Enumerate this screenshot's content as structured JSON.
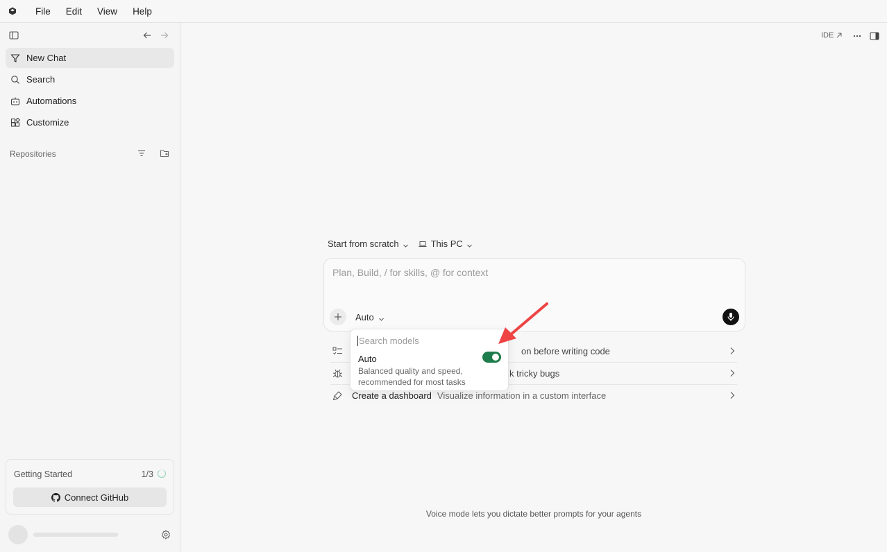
{
  "menubar": {
    "items": [
      "File",
      "Edit",
      "View",
      "Help"
    ]
  },
  "sidebar": {
    "nav": [
      {
        "label": "New Chat",
        "icon": "new-chat-icon",
        "active": true
      },
      {
        "label": "Search",
        "icon": "search-icon"
      },
      {
        "label": "Automations",
        "icon": "automations-icon"
      },
      {
        "label": "Customize",
        "icon": "customize-icon"
      }
    ],
    "repositories_label": "Repositories",
    "getting_started": {
      "title": "Getting Started",
      "progress": "1/3",
      "button": "Connect GitHub"
    }
  },
  "toolbar": {
    "ide_label": "IDE"
  },
  "composer": {
    "start_label": "Start from scratch",
    "location_label": "This PC",
    "placeholder": "Plan, Build, / for skills, @ for context",
    "model_label": "Auto"
  },
  "suggestions": [
    {
      "title": "",
      "desc": "on before writing code",
      "icon": "checklist-icon"
    },
    {
      "title": "",
      "desc": "k tricky bugs",
      "icon": "bug-icon"
    },
    {
      "title": "Create a dashboard",
      "desc": "Visualize information in a custom interface",
      "icon": "paintbrush-icon"
    }
  ],
  "model_dropdown": {
    "search_placeholder": "Search models",
    "item_name": "Auto",
    "item_desc": "Balanced quality and speed, recommended for most tasks",
    "toggle_on": true
  },
  "footer_note": "Voice mode lets you dictate better prompts for your agents",
  "colors": {
    "accent_toggle": "#1e7d4c",
    "annotation_arrow": "#ee4444"
  }
}
